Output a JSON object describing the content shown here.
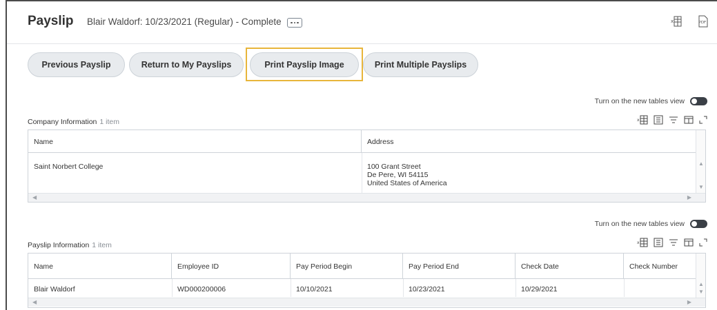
{
  "header": {
    "title": "Payslip",
    "subtitle": "Blair Waldorf: 10/23/2021 (Regular) - Complete",
    "more_icon": "ellipsis-icon",
    "export_excel_icon": "excel-export-icon",
    "export_pdf_icon": "pdf-export-icon",
    "pdf_label": "PDF"
  },
  "actions": {
    "previous": "Previous Payslip",
    "return": "Return to My Payslips",
    "print": "Print Payslip Image",
    "print_multiple": "Print Multiple Payslips"
  },
  "company": {
    "toggle_label": "Turn on the new tables view",
    "title": "Company Information",
    "count": "1 item",
    "columns": [
      "Name",
      "Address"
    ],
    "row": {
      "name": "Saint Norbert College",
      "address_line1": "100 Grant Street",
      "address_line2": "De Pere, WI 54115",
      "address_line3": "United States of America"
    }
  },
  "payslip_info": {
    "toggle_label": "Turn on the new tables view",
    "title": "Payslip Information",
    "count": "1 item",
    "columns": [
      "Name",
      "Employee ID",
      "Pay Period Begin",
      "Pay Period End",
      "Check Date",
      "Check Number"
    ],
    "row": [
      "Blair Waldorf",
      "WD000200006",
      "10/10/2021",
      "10/23/2021",
      "10/29/2021",
      ""
    ]
  },
  "colors": {
    "focus": "#e8b53a",
    "button_bg": "#e8ebee",
    "toggle": "#3a3f46"
  }
}
